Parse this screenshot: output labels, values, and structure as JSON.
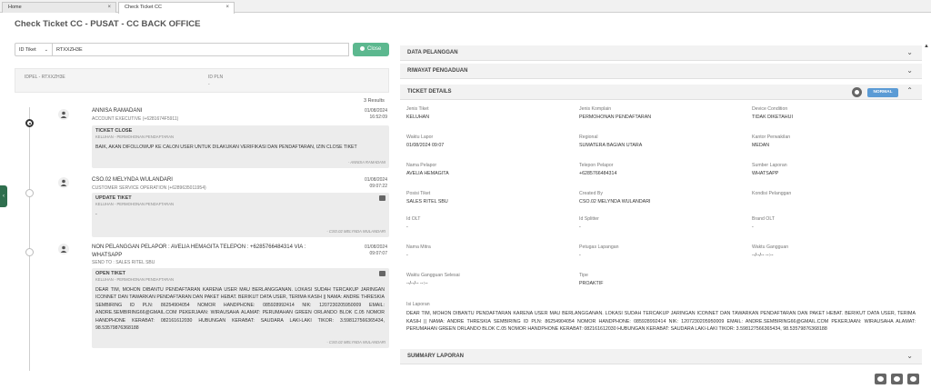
{
  "tabs": [
    {
      "label": "Home",
      "close": "×"
    },
    {
      "label": "Check Ticket CC",
      "close": "×"
    }
  ],
  "page_title": "Check Ticket CC - PUSAT - CC BACK OFFICE",
  "search": {
    "select_value": "ID Tiket",
    "input_value": "RTXXZH3E",
    "close_label": "Close"
  },
  "idpel": {
    "idpel_label": "IDPEL - RTXXZH3E",
    "idpln_label": "ID PLN",
    "idpln_value": "-"
  },
  "results_label": "3 Results",
  "timeline": [
    {
      "name": "ANNISA RAMADANI",
      "role": "ACCOUNT EXECUTIVE (+6281674F5911)",
      "date": "01/08/2024",
      "time": "16:52:09",
      "card_title": "TICKET CLOSE",
      "card_sub": "KELUHAN - PERMOHONAN PENDAFTARAN",
      "card_body": "BAIK, AKAN DIFOLLOWUP KE CALON USER UNTUK DILAKUKAN VERIFIKASI DAN PENDAFTARAN, IZIN CLOSE TIKET",
      "card_foot": "- ANNISA RAMADANI"
    },
    {
      "name": "CSO.02 MELYNDA WULANDARI",
      "role": "CUSTOMER SERVICE OPERATION (+6289635011954)",
      "date": "01/08/2024",
      "time": "09:07:22",
      "card_title": "UPDATE TIKET",
      "card_sub": "KELUHAN - PERMOHONAN PENDAFTARAN",
      "card_body": "-",
      "card_foot": "- CSO.02 MELYNDA WULANDARI"
    },
    {
      "name": "NON PELANGGAN PELAPOR : AVELIA HEMAGITA TELEPON : +6285766484314 VIA : WHATSAPP",
      "role": "SEND TO : SALES RITEL SBU",
      "date": "01/08/2024",
      "time": "09:07:07",
      "card_title": "OPEN TIKET",
      "card_sub": "KELUHAN - PERMOHONAN PENDAFTARAN",
      "card_body": "DEAR TIM, MOHON DIBANTU PENDAFTARAN KARENA USER MAU BERLANGGANAN. LOKASI SUDAH TERCAKUP JARINGAN ICONNET DAN TAWARKAN PENDAFTARAN DAN PAKET HEBAT. BERIKUT DATA USER, TERIMA KASIH || NAMA: ANDRE THRESKIA SEMBIRING ID PLN: 86254904054 NOMOR HANDPHONE: 085928992414 NIK: 1207230205950009 EMAIL: ANDRE.SEMBIRING66@GMAIL.COM PEKERJAAN: WIRAUSAHA ALAMAT: PERUMAHAN GREEN ORLANDO BLOK C.05 NOMOR HANDPHONE KERABAT: 082161612030 HUBUNGAN KERABAT: SAUDARA LAKI-LAKI TIKOR: 3.598127566365434, 98.53579876368188",
      "card_foot": "- CSO.02 MELYNDA WULANDARI"
    }
  ],
  "right": {
    "acc_data_pelanggan": "DATA PELANGGAN",
    "acc_riwayat": "RIWAYAT PENGADUAN",
    "acc_ticket_details": "TICKET DETAILS",
    "status_badge": "NORMAL",
    "acc_summary": "SUMMARY LAPORAN",
    "fields": [
      {
        "label": "Jenis Tiket",
        "value": "KELUHAN"
      },
      {
        "label": "Jenis Komplain",
        "value": "PERMOHONAN PENDAFTARAN"
      },
      {
        "label": "Device Condition",
        "value": "TIDAK DIKETAHUI"
      },
      {
        "label": "Waktu Lapor",
        "value": "01/08/2024 09:07"
      },
      {
        "label": "Regional",
        "value": "SUMATERA BAGIAN UTARA"
      },
      {
        "label": "Kantor Perwakilan",
        "value": "MEDAN"
      },
      {
        "label": "Nama Pelapor",
        "value": "AVELIA HEMAGITA"
      },
      {
        "label": "Telepon Pelapor",
        "value": "+6285766484314"
      },
      {
        "label": "Sumber Laporan",
        "value": "WHATSAPP"
      },
      {
        "label": "Posisi Tiket",
        "value": "SALES RITEL SBU"
      },
      {
        "label": "Created By",
        "value": "CSO.02 MELYNDA WULANDARI"
      },
      {
        "label": "Kondisi Pelanggan",
        "value": ""
      },
      {
        "label": "Id OLT",
        "value": "-"
      },
      {
        "label": "Id Splitter",
        "value": "-"
      },
      {
        "label": "Brand OLT",
        "value": "-"
      },
      {
        "label": "Nama Mitra",
        "value": "-"
      },
      {
        "label": "Petugas Lapangan",
        "value": "-"
      },
      {
        "label": "Waktu Gangguan",
        "value": "--/--/-- --:--"
      },
      {
        "label": "Waktu Gangguan Selesai",
        "value": "--/--/-- --:--"
      },
      {
        "label": "Tipe",
        "value": "PROAKTIF"
      }
    ],
    "isi_label": "Isi Laporan",
    "isi_value": "DEAR TIM, MOHON DIBANTU PENDAFTARAN KARENA USER MAU BERLANGGANAN. LOKASI SUDAH TERCAKUP JARINGAN ICONNET DAN TAWARKAN PENDAFTARAN DAN PAKET HEBAT. BERIKUT DATA USER, TERIMA KASIH || NAMA: ANDRE THRESKIA SEMBIRING ID PLN: 86254904054 NOMOR HANDPHONE: 085928992414 NIK: 1207230205950009 EMAIL: ANDRE.SEMBIRING66@GMAIL.COM PEKERJAAN: WIRAUSAHA ALAMAT: PERUMAHAN GREEN ORLANDO BLOK C.05 NOMOR HANDPHONE KERABAT: 082161612030 HUBUNGAN KERABAT: SAUDARA LAKI-LAKI TIKOR: 3.598127566365434, 98.53579876368188"
  }
}
